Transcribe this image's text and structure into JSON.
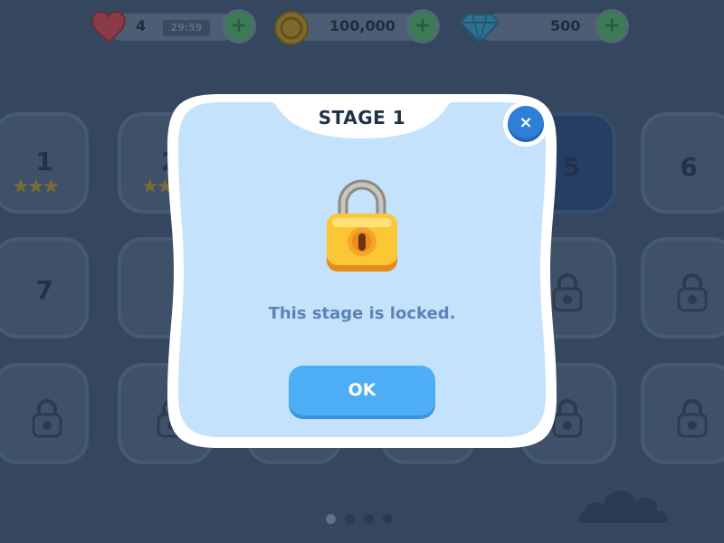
{
  "resources": {
    "lives": {
      "icon": "heart-icon",
      "value": "4",
      "timer": "29:59"
    },
    "coins": {
      "icon": "coin-icon",
      "value": "100,000"
    },
    "gems": {
      "icon": "gem-icon",
      "value": "500"
    },
    "plus_label": "+"
  },
  "stages": {
    "tile1": {
      "number": "1",
      "stars": "★★★"
    },
    "tile2": {
      "number": "2",
      "stars": "★★"
    },
    "tile5": {
      "number": "5"
    },
    "tile6": {
      "number": "6"
    },
    "tile7": {
      "number": "7"
    }
  },
  "pagination": {
    "pages": 4,
    "current": 1
  },
  "modal": {
    "title": "STAGE 1",
    "message": "This stage is locked.",
    "ok_label": "OK",
    "close_label": "×"
  },
  "colors": {
    "background": "#35475f",
    "modal_fill": "#c5e2fc",
    "ok_button": "#4daef5",
    "close_button": "#2f7fd9",
    "message_text": "#5b84b5"
  }
}
